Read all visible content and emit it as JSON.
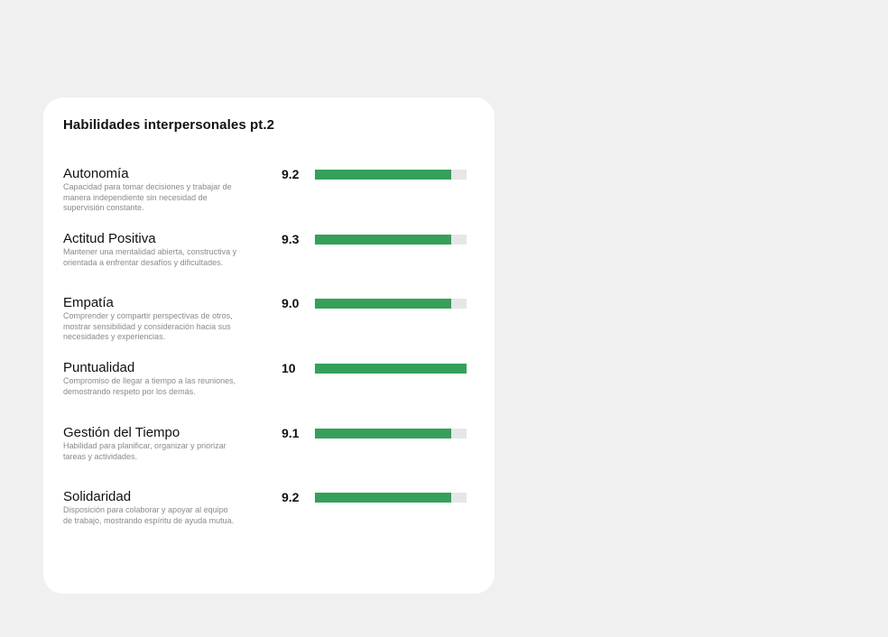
{
  "card": {
    "title": "Habilidades interpersonales pt.2"
  },
  "colors": {
    "background": "#eff0ef",
    "card": "#ffffff",
    "bar_fill": "#34a05a",
    "bar_track": "#e6e6e6"
  },
  "skills": [
    {
      "name": "Autonomía",
      "description": "Capacidad para tomar decisiones y trabajar de manera independiente sin necesidad de supervisión constante.",
      "score": "9.2",
      "fill_fraction": 0.9
    },
    {
      "name": "Actitud Positiva",
      "description": "Mantener una mentalidad abierta, constructiva y orientada a enfrentar desafíos y dificultades.",
      "score": "9.3",
      "fill_fraction": 0.9
    },
    {
      "name": "Empatía",
      "description": "Comprender y compartir perspectivas de otros, mostrar sensibilidad y consideración hacia sus necesidades y experiencias.",
      "score": "9.0",
      "fill_fraction": 0.9
    },
    {
      "name": "Puntualidad",
      "description": "Compromiso de llegar a tiempo a las reuniones, demostrando respeto por los demás.",
      "score": "10",
      "fill_fraction": 1.0
    },
    {
      "name": "Gestión del Tiempo",
      "description": "Habilidad para planificar, organizar y priorizar tareas y actividades.",
      "score": "9.1",
      "fill_fraction": 0.9
    },
    {
      "name": "Solidaridad",
      "description": "Disposición para colaborar y apoyar al equipo de trabajo, mostrando espíritu de ayuda mutua.",
      "score": "9.2",
      "fill_fraction": 0.9
    }
  ]
}
